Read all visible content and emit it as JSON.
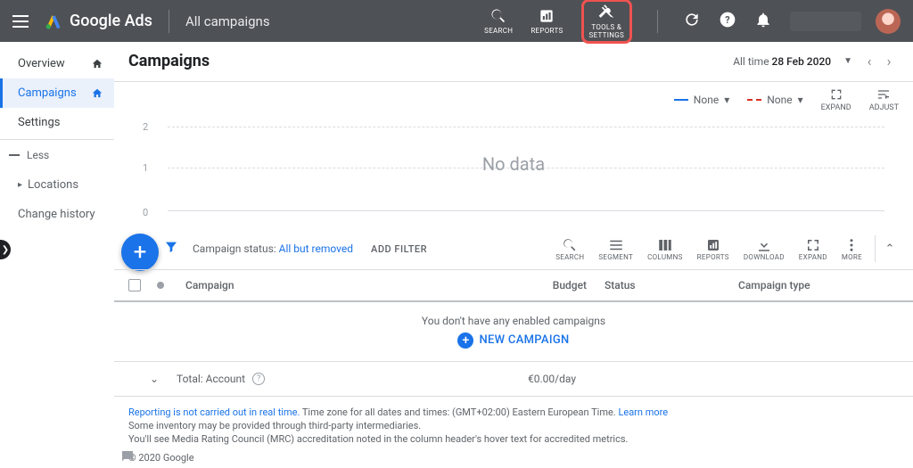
{
  "topbar": {
    "brand": "Google Ads",
    "context": "All campaigns",
    "tools": {
      "search": "SEARCH",
      "reports": "REPORTS",
      "tools_settings_l1": "TOOLS &",
      "tools_settings_l2": "SETTINGS"
    }
  },
  "sidebar": {
    "overview": "Overview",
    "campaigns": "Campaigns",
    "settings": "Settings",
    "less": "Less",
    "locations": "Locations",
    "change_history": "Change history"
  },
  "page": {
    "title": "Campaigns",
    "range_prefix": "All time ",
    "range_value": "28 Feb 2020"
  },
  "chart_data": {
    "type": "line",
    "title": "",
    "series": [
      {
        "name": "None",
        "color": "#1a73e8",
        "values": []
      },
      {
        "name": "None",
        "color": "#d93025",
        "values": []
      }
    ],
    "yticks": [
      0,
      1,
      2
    ],
    "ylim": [
      0,
      2
    ],
    "x": [],
    "no_data_text": "No data",
    "controls": {
      "expand": "EXPAND",
      "adjust": "ADJUST"
    }
  },
  "filterbar": {
    "status_prefix": "Campaign status: ",
    "status_value": "All but removed",
    "add_filter": "ADD FILTER",
    "tools": {
      "search": "SEARCH",
      "segment": "SEGMENT",
      "columns": "COLUMNS",
      "reports": "REPORTS",
      "download": "DOWNLOAD",
      "expand": "EXPAND",
      "more": "MORE"
    }
  },
  "columns": {
    "campaign": "Campaign",
    "budget": "Budget",
    "status": "Status",
    "type": "Campaign type"
  },
  "empty": {
    "msg": "You don't have any enabled campaigns",
    "cta": "NEW CAMPAIGN"
  },
  "total": {
    "label": "Total: Account",
    "budget": "€0.00/day"
  },
  "footer": {
    "link1": "Reporting is not carried out in real time.",
    "tz": " Time zone for all dates and times: (GMT+02:00) Eastern European Time. ",
    "learn": "Learn more",
    "line2": "Some inventory may be provided through third-party intermediaries.",
    "line3": "You'll see Media Rating Council (MRC) accreditation noted in the column header's hover text for accredited metrics.",
    "cpy": "© 2020 Google"
  }
}
